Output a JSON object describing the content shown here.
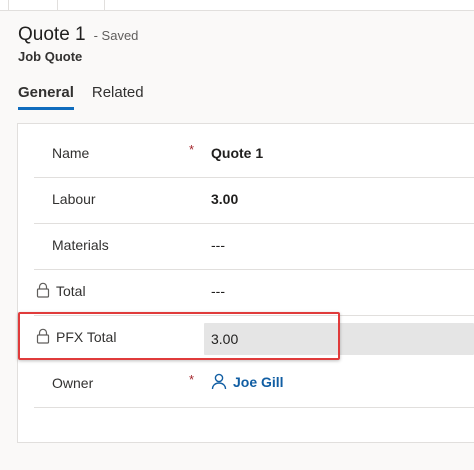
{
  "header": {
    "title": "Quote 1",
    "status": "- Saved",
    "entity_type": "Job Quote"
  },
  "tabs": [
    {
      "label": "General",
      "active": true
    },
    {
      "label": "Related",
      "active": false
    }
  ],
  "fields": {
    "name": {
      "label": "Name",
      "required": "*",
      "value": "Quote 1"
    },
    "labour": {
      "label": "Labour",
      "value": "3.00"
    },
    "materials": {
      "label": "Materials",
      "value": "---"
    },
    "total": {
      "label": "Total",
      "value": "---",
      "locked": true
    },
    "pfx_total": {
      "label": "PFX Total",
      "value": "3.00",
      "locked": true,
      "highlighted": true
    },
    "owner": {
      "label": "Owner",
      "required": "*",
      "value": "Joe Gill"
    }
  },
  "colors": {
    "accent": "#0f6cbd",
    "link": "#115ea3",
    "required": "#a4262c",
    "highlight_border": "#e03b3b",
    "readonly_fill": "#e5e5e5"
  },
  "icons": {
    "lock": "lock-icon",
    "owner": "person-icon"
  }
}
